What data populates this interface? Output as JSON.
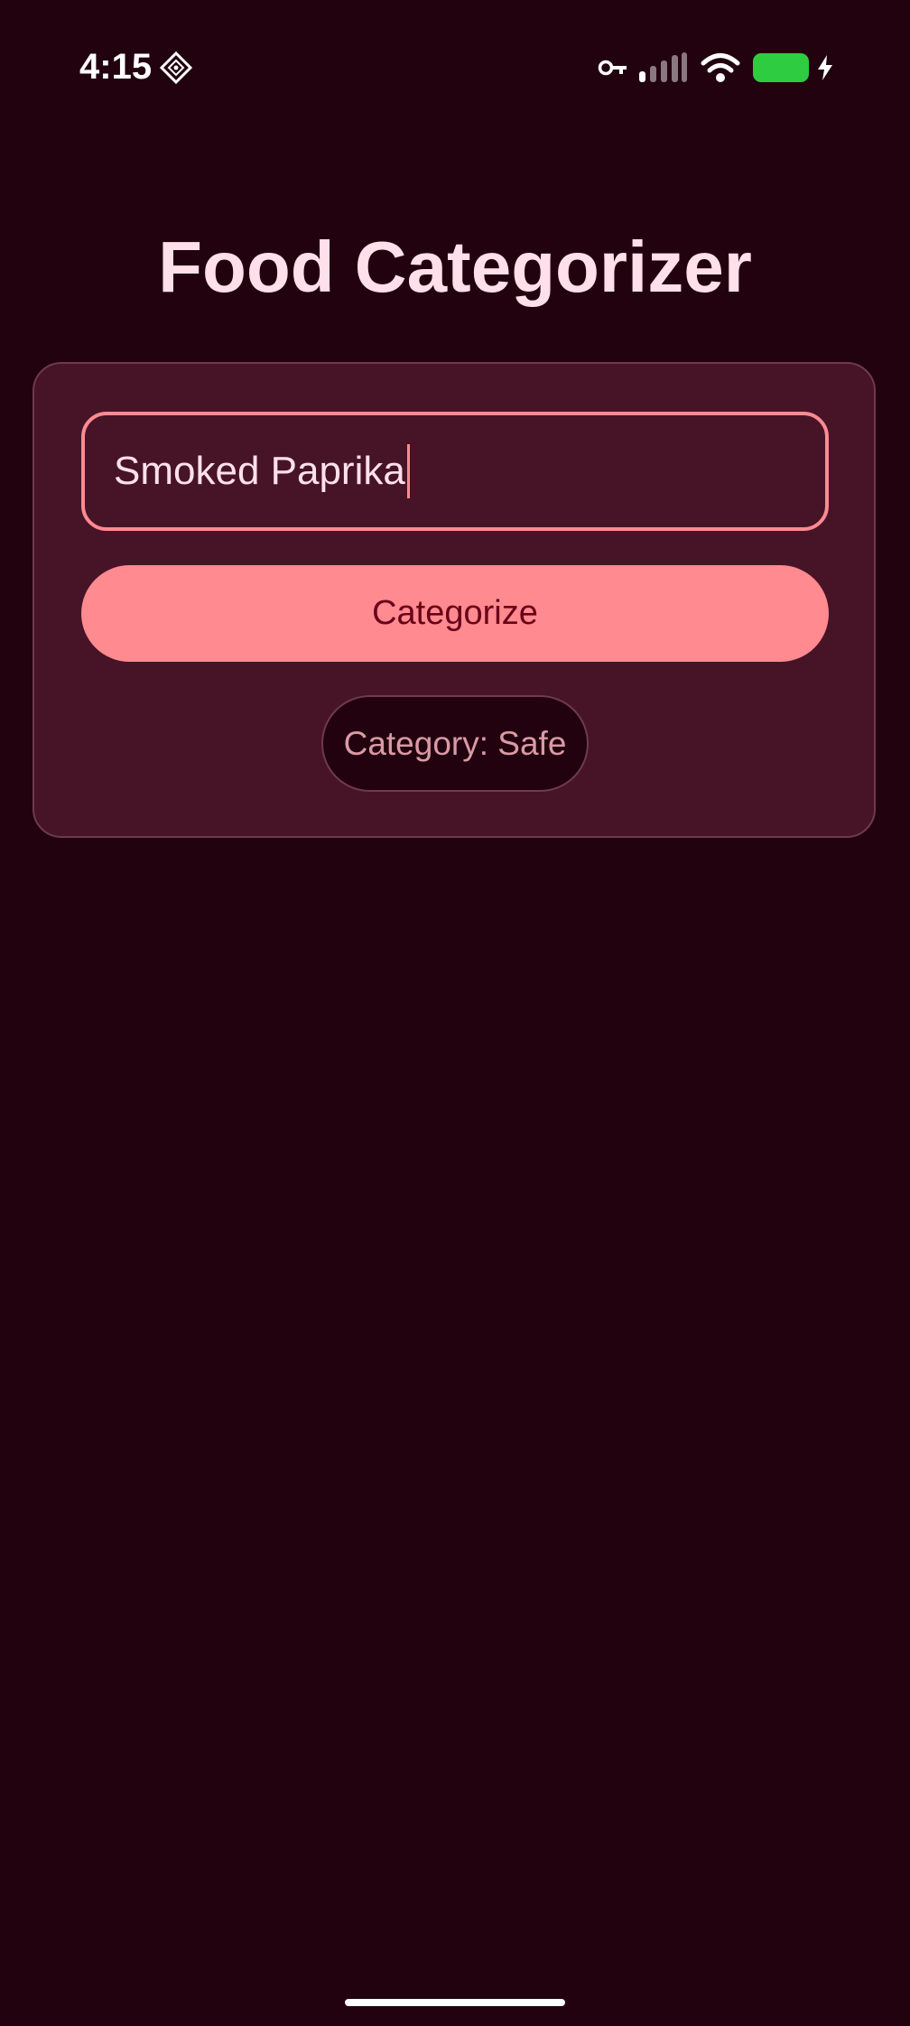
{
  "status_bar": {
    "time": "4:15",
    "icons": [
      "app-diamond-icon",
      "key-icon",
      "cellular-signal-icon",
      "wifi-icon",
      "battery-charging-icon"
    ],
    "battery_color": "#2ecc40"
  },
  "title": "Food Categorizer",
  "form": {
    "input_value": "Smoked Paprika",
    "button_label": "Categorize",
    "result": "Category: Safe"
  },
  "colors": {
    "background": "#22020e",
    "card": "#471427",
    "accent": "#ff8a8f",
    "title_text": "#ffe0ea"
  }
}
